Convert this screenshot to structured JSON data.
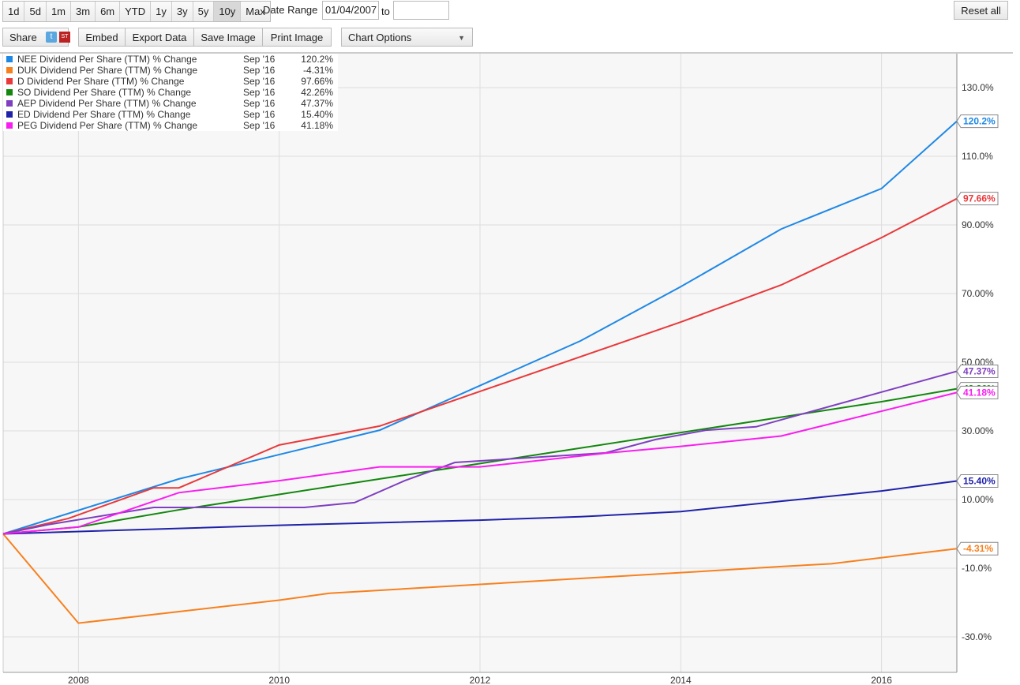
{
  "toolbar": {
    "ranges": [
      "1d",
      "5d",
      "1m",
      "3m",
      "6m",
      "YTD",
      "1y",
      "3y",
      "5y",
      "10y",
      "Max"
    ],
    "active_range": "10y",
    "date_range_label": "Date Range",
    "date_from": "01/04/2007",
    "to_label": "to",
    "date_to": "",
    "reset_label": "Reset all",
    "share_label": "Share",
    "embed_label": "Embed",
    "export_label": "Export Data",
    "save_label": "Save Image",
    "print_label": "Print Image",
    "chart_options_label": "Chart Options"
  },
  "legend": [
    {
      "name": "NEE Dividend Per Share (TTM) % Change",
      "date": "Sep '16",
      "value": "120.2%",
      "color": "#1f88e5"
    },
    {
      "name": "DUK Dividend Per Share (TTM) % Change",
      "date": "Sep '16",
      "value": "-4.31%",
      "color": "#f7801e"
    },
    {
      "name": "D Dividend Per Share (TTM) % Change",
      "date": "Sep '16",
      "value": "97.66%",
      "color": "#e8393b"
    },
    {
      "name": "SO Dividend Per Share (TTM) % Change",
      "date": "Sep '16",
      "value": "42.26%",
      "color": "#13870f"
    },
    {
      "name": "AEP Dividend Per Share (TTM) % Change",
      "date": "Sep '16",
      "value": "47.37%",
      "color": "#7e3fc0"
    },
    {
      "name": "ED Dividend Per Share (TTM) % Change",
      "date": "Sep '16",
      "value": "15.40%",
      "color": "#1f22a8"
    },
    {
      "name": "PEG Dividend Per Share (TTM) % Change",
      "date": "Sep '16",
      "value": "41.18%",
      "color": "#f81ef0"
    }
  ],
  "chart_data": {
    "type": "line",
    "xlim": [
      2007.25,
      2016.75
    ],
    "ylim": [
      -40,
      140
    ],
    "x_ticks": [
      "2008",
      "2010",
      "2012",
      "2014",
      "2016"
    ],
    "x_tick_values": [
      2008,
      2010,
      2012,
      2014,
      2016
    ],
    "y_ticks": [
      "130.0%",
      "110.0%",
      "90.00%",
      "70.00%",
      "50.00%",
      "30.00%",
      "10.00%",
      "-10.0%",
      "-30.0%"
    ],
    "y_tick_values": [
      130,
      110,
      90,
      70,
      50,
      30,
      10,
      -10,
      -30
    ],
    "grid": true,
    "series": [
      {
        "name": "NEE",
        "label": "120.2%",
        "color": "#1f88e5",
        "x": [
          2007.25,
          2009,
          2011,
          2013,
          2014,
          2015,
          2016,
          2016.75
        ],
        "y": [
          0,
          16,
          30.2,
          56.2,
          72,
          88.8,
          100.6,
          120.2
        ]
      },
      {
        "name": "DUK",
        "label": "-4.31%",
        "color": "#f7801e",
        "x": [
          2007.25,
          2008,
          2010,
          2010.5,
          2012,
          2014,
          2015,
          2015.5,
          2016.75
        ],
        "y": [
          0,
          -26,
          -19.3,
          -17.3,
          -14.7,
          -11.3,
          -9.5,
          -8.7,
          -4.31
        ]
      },
      {
        "name": "D",
        "label": "97.66%",
        "color": "#e8393b",
        "x": [
          2007.25,
          2007.9,
          2008.75,
          2009,
          2010,
          2011,
          2012,
          2014,
          2015,
          2016,
          2016.75
        ],
        "y": [
          0,
          4.5,
          13.4,
          13.4,
          25.9,
          31.4,
          41.5,
          61.7,
          72.5,
          86.3,
          97.66
        ]
      },
      {
        "name": "SO",
        "label": "42.26%",
        "color": "#13870f",
        "x": [
          2007.25,
          2008,
          2009,
          2010,
          2011,
          2012,
          2013,
          2014,
          2015,
          2016,
          2016.75
        ],
        "y": [
          0,
          2,
          7,
          11.5,
          16,
          20.5,
          25,
          29.5,
          34,
          38.5,
          42.26
        ]
      },
      {
        "name": "AEP",
        "label": "47.37%",
        "color": "#7e3fc0",
        "x": [
          2007.25,
          2007.7,
          2008.75,
          2010.25,
          2010.75,
          2011.25,
          2011.75,
          2013.25,
          2013.75,
          2014.25,
          2014.75,
          2016.75
        ],
        "y": [
          0,
          2.7,
          7.7,
          7.7,
          9.1,
          15.5,
          20.8,
          23.6,
          27.5,
          30.2,
          31.2,
          47.37
        ]
      },
      {
        "name": "ED",
        "label": "15.40%",
        "color": "#1f22a8",
        "x": [
          2007.25,
          2010,
          2012,
          2013,
          2014,
          2015,
          2016,
          2016.75
        ],
        "y": [
          0,
          2.5,
          4,
          5,
          6.5,
          9.5,
          12.5,
          15.4
        ]
      },
      {
        "name": "PEG",
        "label": "41.18%",
        "color": "#f81ef0",
        "x": [
          2007.25,
          2008,
          2009,
          2010,
          2011,
          2011.75,
          2012,
          2013.25,
          2014,
          2015,
          2016.75
        ],
        "y": [
          0,
          2,
          12,
          15.5,
          19.5,
          19.5,
          19.5,
          23.5,
          25.5,
          28.5,
          41.18
        ]
      }
    ]
  }
}
